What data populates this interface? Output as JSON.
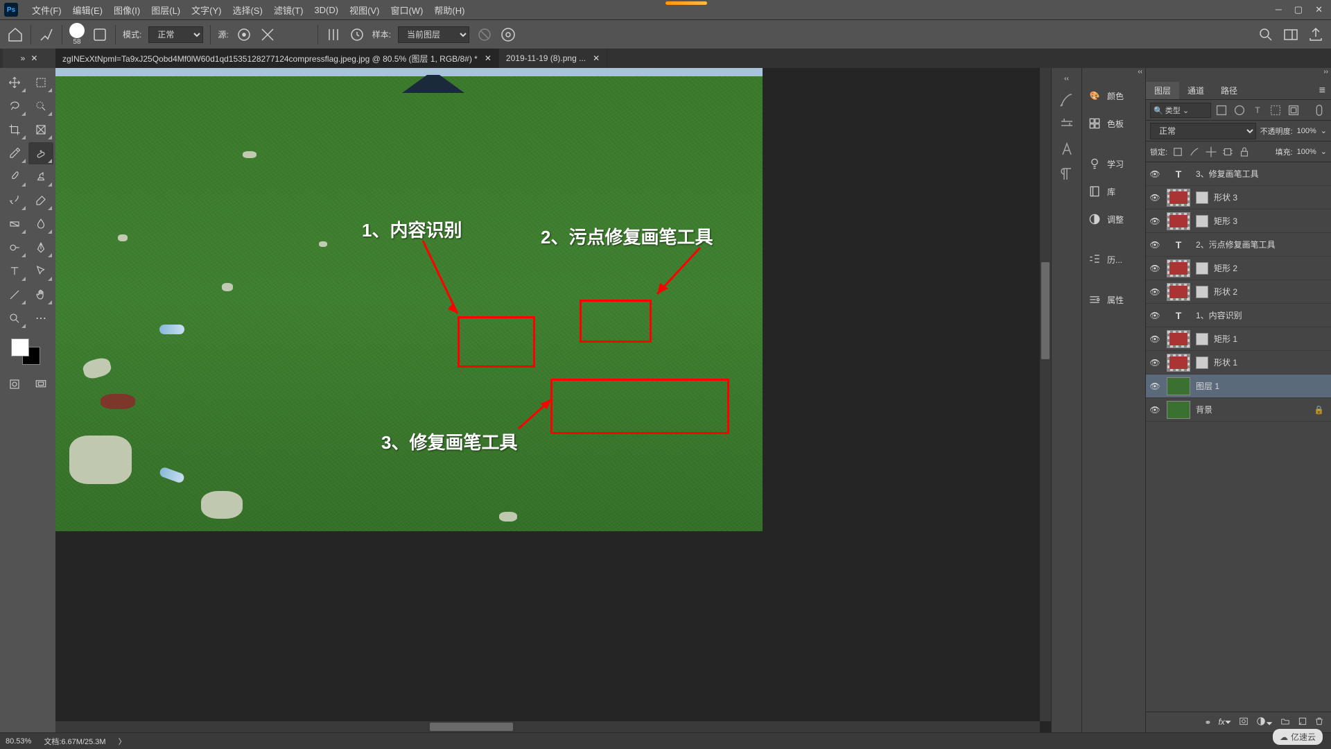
{
  "app": {
    "logo": "Ps"
  },
  "menu": {
    "file": "文件(F)",
    "edit": "编辑(E)",
    "image": "图像(I)",
    "layer": "图层(L)",
    "type": "文字(Y)",
    "select": "选择(S)",
    "filter": "滤镜(T)",
    "threeD": "3D(D)",
    "view": "视图(V)",
    "window": "窗口(W)",
    "help": "帮助(H)"
  },
  "options": {
    "brush_size": "58",
    "mode_label": "模式:",
    "mode_value": "正常",
    "source_label": "源:",
    "sample_label": "样本:",
    "sample_value": "当前图层"
  },
  "tabs": {
    "active": "zgINExXtNpml=Ta9xJ25Qobd4Mf0lW60d1qd1535128277124compressflag.jpeg.jpg  @  80.5%  (图层 1, RGB/8#) *",
    "inactive": "2019-11-19 (8).png ..."
  },
  "annotations": {
    "a1": "1、内容识别",
    "a2": "2、污点修复画笔工具",
    "a3": "3、修复画笔工具"
  },
  "collapsed_panels": {
    "color": "颜色",
    "swatches": "色板",
    "learn": "学习",
    "libraries": "库",
    "adjustments": "调整",
    "history": "历...",
    "properties": "属性"
  },
  "layers_panel": {
    "tab_layers": "图层",
    "tab_channels": "通道",
    "tab_paths": "路径",
    "filter_kind": "类型",
    "blend_mode": "正常",
    "opacity_label": "不透明度:",
    "opacity_value": "100%",
    "lock_label": "锁定:",
    "fill_label": "填充:",
    "fill_value": "100%",
    "layers": [
      {
        "name": "3、修复画笔工具",
        "type": "text"
      },
      {
        "name": "形状 3",
        "type": "shape"
      },
      {
        "name": "矩形 3",
        "type": "shape"
      },
      {
        "name": "2、污点修复画笔工具",
        "type": "text"
      },
      {
        "name": "矩形 2",
        "type": "shape"
      },
      {
        "name": "形状 2",
        "type": "shape"
      },
      {
        "name": "1、内容识别",
        "type": "text"
      },
      {
        "name": "矩形 1",
        "type": "shape"
      },
      {
        "name": "形状 1",
        "type": "shape"
      },
      {
        "name": "图层 1",
        "type": "image",
        "selected": true
      },
      {
        "name": "背景",
        "type": "image",
        "locked": true
      }
    ]
  },
  "status": {
    "zoom": "80.53%",
    "doc": "文档:6.67M/25.3M"
  },
  "watermark": "亿速云"
}
